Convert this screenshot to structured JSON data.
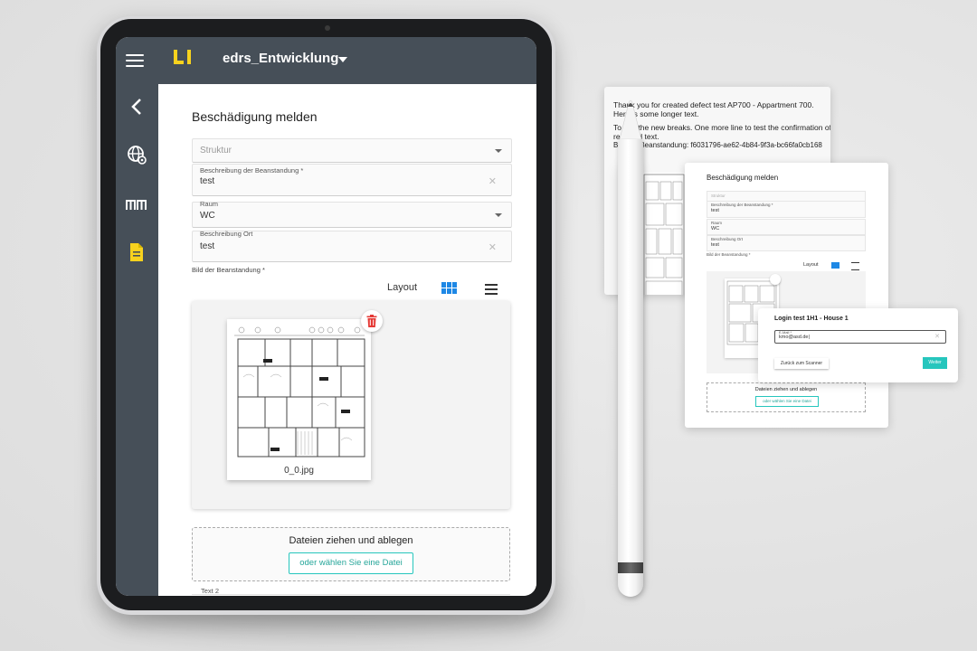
{
  "header": {
    "app_title": "edrs_Entwicklung",
    "logo_text": "Li"
  },
  "sidebar": {
    "items": [
      {
        "name": "back",
        "icon": "back-arrow-icon"
      },
      {
        "name": "globe-settings",
        "icon": "globe-gear-icon"
      },
      {
        "name": "measurement",
        "icon": "mm-icon"
      },
      {
        "name": "document",
        "icon": "document-icon",
        "active": true
      }
    ]
  },
  "form": {
    "title": "Beschädigung melden",
    "struktur_placeholder": "Struktur",
    "beschreibung_label": "Beschreibung der Beanstandung *",
    "beschreibung_value": "test",
    "raum_label": "Raum",
    "raum_value": "WC",
    "ort_label": "Beschreibung Ort",
    "ort_value": "test",
    "bild_label": "Bild der Beanstandung *",
    "layout_label": "Layout",
    "image_name": "0_0.jpg",
    "dropzone_title": "Dateien ziehen und ablegen",
    "dropzone_button": "oder wählen Sie eine Datei",
    "text2_label": "Text 2"
  },
  "email": {
    "lines": [
      "Thank you for created defect test AP700 - Appartment 700.",
      "Here is some longer text.",
      "To test the new breaks. One more line to test the confirmation of",
      "received text.",
      "Bild der Beanstandung: f6031796-ae62-4b84-9f3a-bc66fa0cb168"
    ]
  },
  "mini_form": {
    "title": "Beschädigung melden",
    "struktur_placeholder": "Struktur",
    "beschreibung_label": "Beschreibung der Beanstandung *",
    "beschreibung_value": "test",
    "raum_label": "Raum",
    "raum_value": "WC",
    "ort_label": "Beschreibung Ort",
    "ort_value": "test",
    "bild_label": "Bild der Beanstandung *",
    "layout_label": "Layout",
    "dropzone_title": "Dateien ziehen und ablegen",
    "dropzone_button": "oder wählen Sie eine Datei"
  },
  "login": {
    "title": "Login test 1H1 - House 1",
    "email_label": "E-Mail *",
    "email_value": "kmo@asd.de|",
    "back_button": "Zurück zum Scanner",
    "next_button": "Weiter"
  },
  "colors": {
    "topbar": "#464f58",
    "accent_teal": "#26c6bd",
    "logo_yellow": "#f7d21e",
    "delete_red": "#e53935",
    "grid_blue": "#1e88e5"
  }
}
